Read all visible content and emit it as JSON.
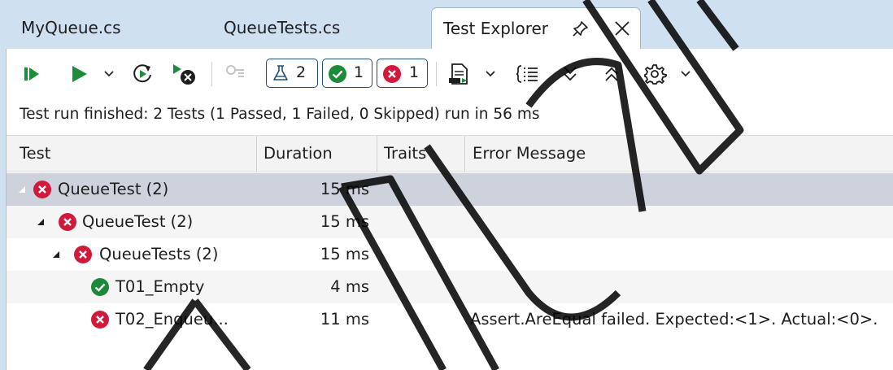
{
  "tabs": [
    {
      "label": "MyQueue.cs",
      "active": false
    },
    {
      "label": "QueueTests.cs",
      "active": false
    },
    {
      "label": "Test Explorer",
      "active": true
    }
  ],
  "toolbar": {
    "counters": {
      "total": "2",
      "passed": "1",
      "failed": "1"
    },
    "icons": [
      "run-all-icon",
      "run-icon",
      "dropdown-chevron-icon",
      "repeat-last-run-icon",
      "cancel-run-icon",
      "filter-icon",
      "total-tests-icon",
      "passed-icon",
      "failed-icon",
      "playlist-icon",
      "dropdown-chevron-icon",
      "group-by-icon",
      "expand-all-icon",
      "collapse-all-icon",
      "settings-icon",
      "dropdown-chevron-icon"
    ]
  },
  "status": "Test run finished: 2 Tests (1 Passed, 1 Failed, 0 Skipped) run in 56 ms",
  "columns": [
    "Test",
    "Duration",
    "Traits",
    "Error Message"
  ],
  "rows": [
    {
      "name": "QueueTest",
      "count": "(2)",
      "duration": "15 ms",
      "error": "",
      "status": "failed",
      "level": 0
    },
    {
      "name": "QueueTest",
      "count": "(2)",
      "duration": "15 ms",
      "error": "",
      "status": "failed",
      "level": 1
    },
    {
      "name": "QueueTests",
      "count": "(2)",
      "duration": "15 ms",
      "error": "",
      "status": "failed",
      "level": 2
    },
    {
      "name": "T01_Empty",
      "count": "",
      "duration": "4 ms",
      "error": "",
      "status": "passed",
      "level": 3
    },
    {
      "name": "T02_Enqueu...",
      "count": "",
      "duration": "11 ms",
      "error": "Assert.AreEqual failed. Expected:<1>. Actual:<0>.",
      "status": "failed",
      "level": 3
    }
  ],
  "colors": {
    "tabstrip": "#cfe0f1",
    "accent": "#1e4e79",
    "failed": "#d1193c",
    "passed": "#1d8a3a",
    "run": "#1f8c3b",
    "selected_row": "#cdd2dd"
  }
}
